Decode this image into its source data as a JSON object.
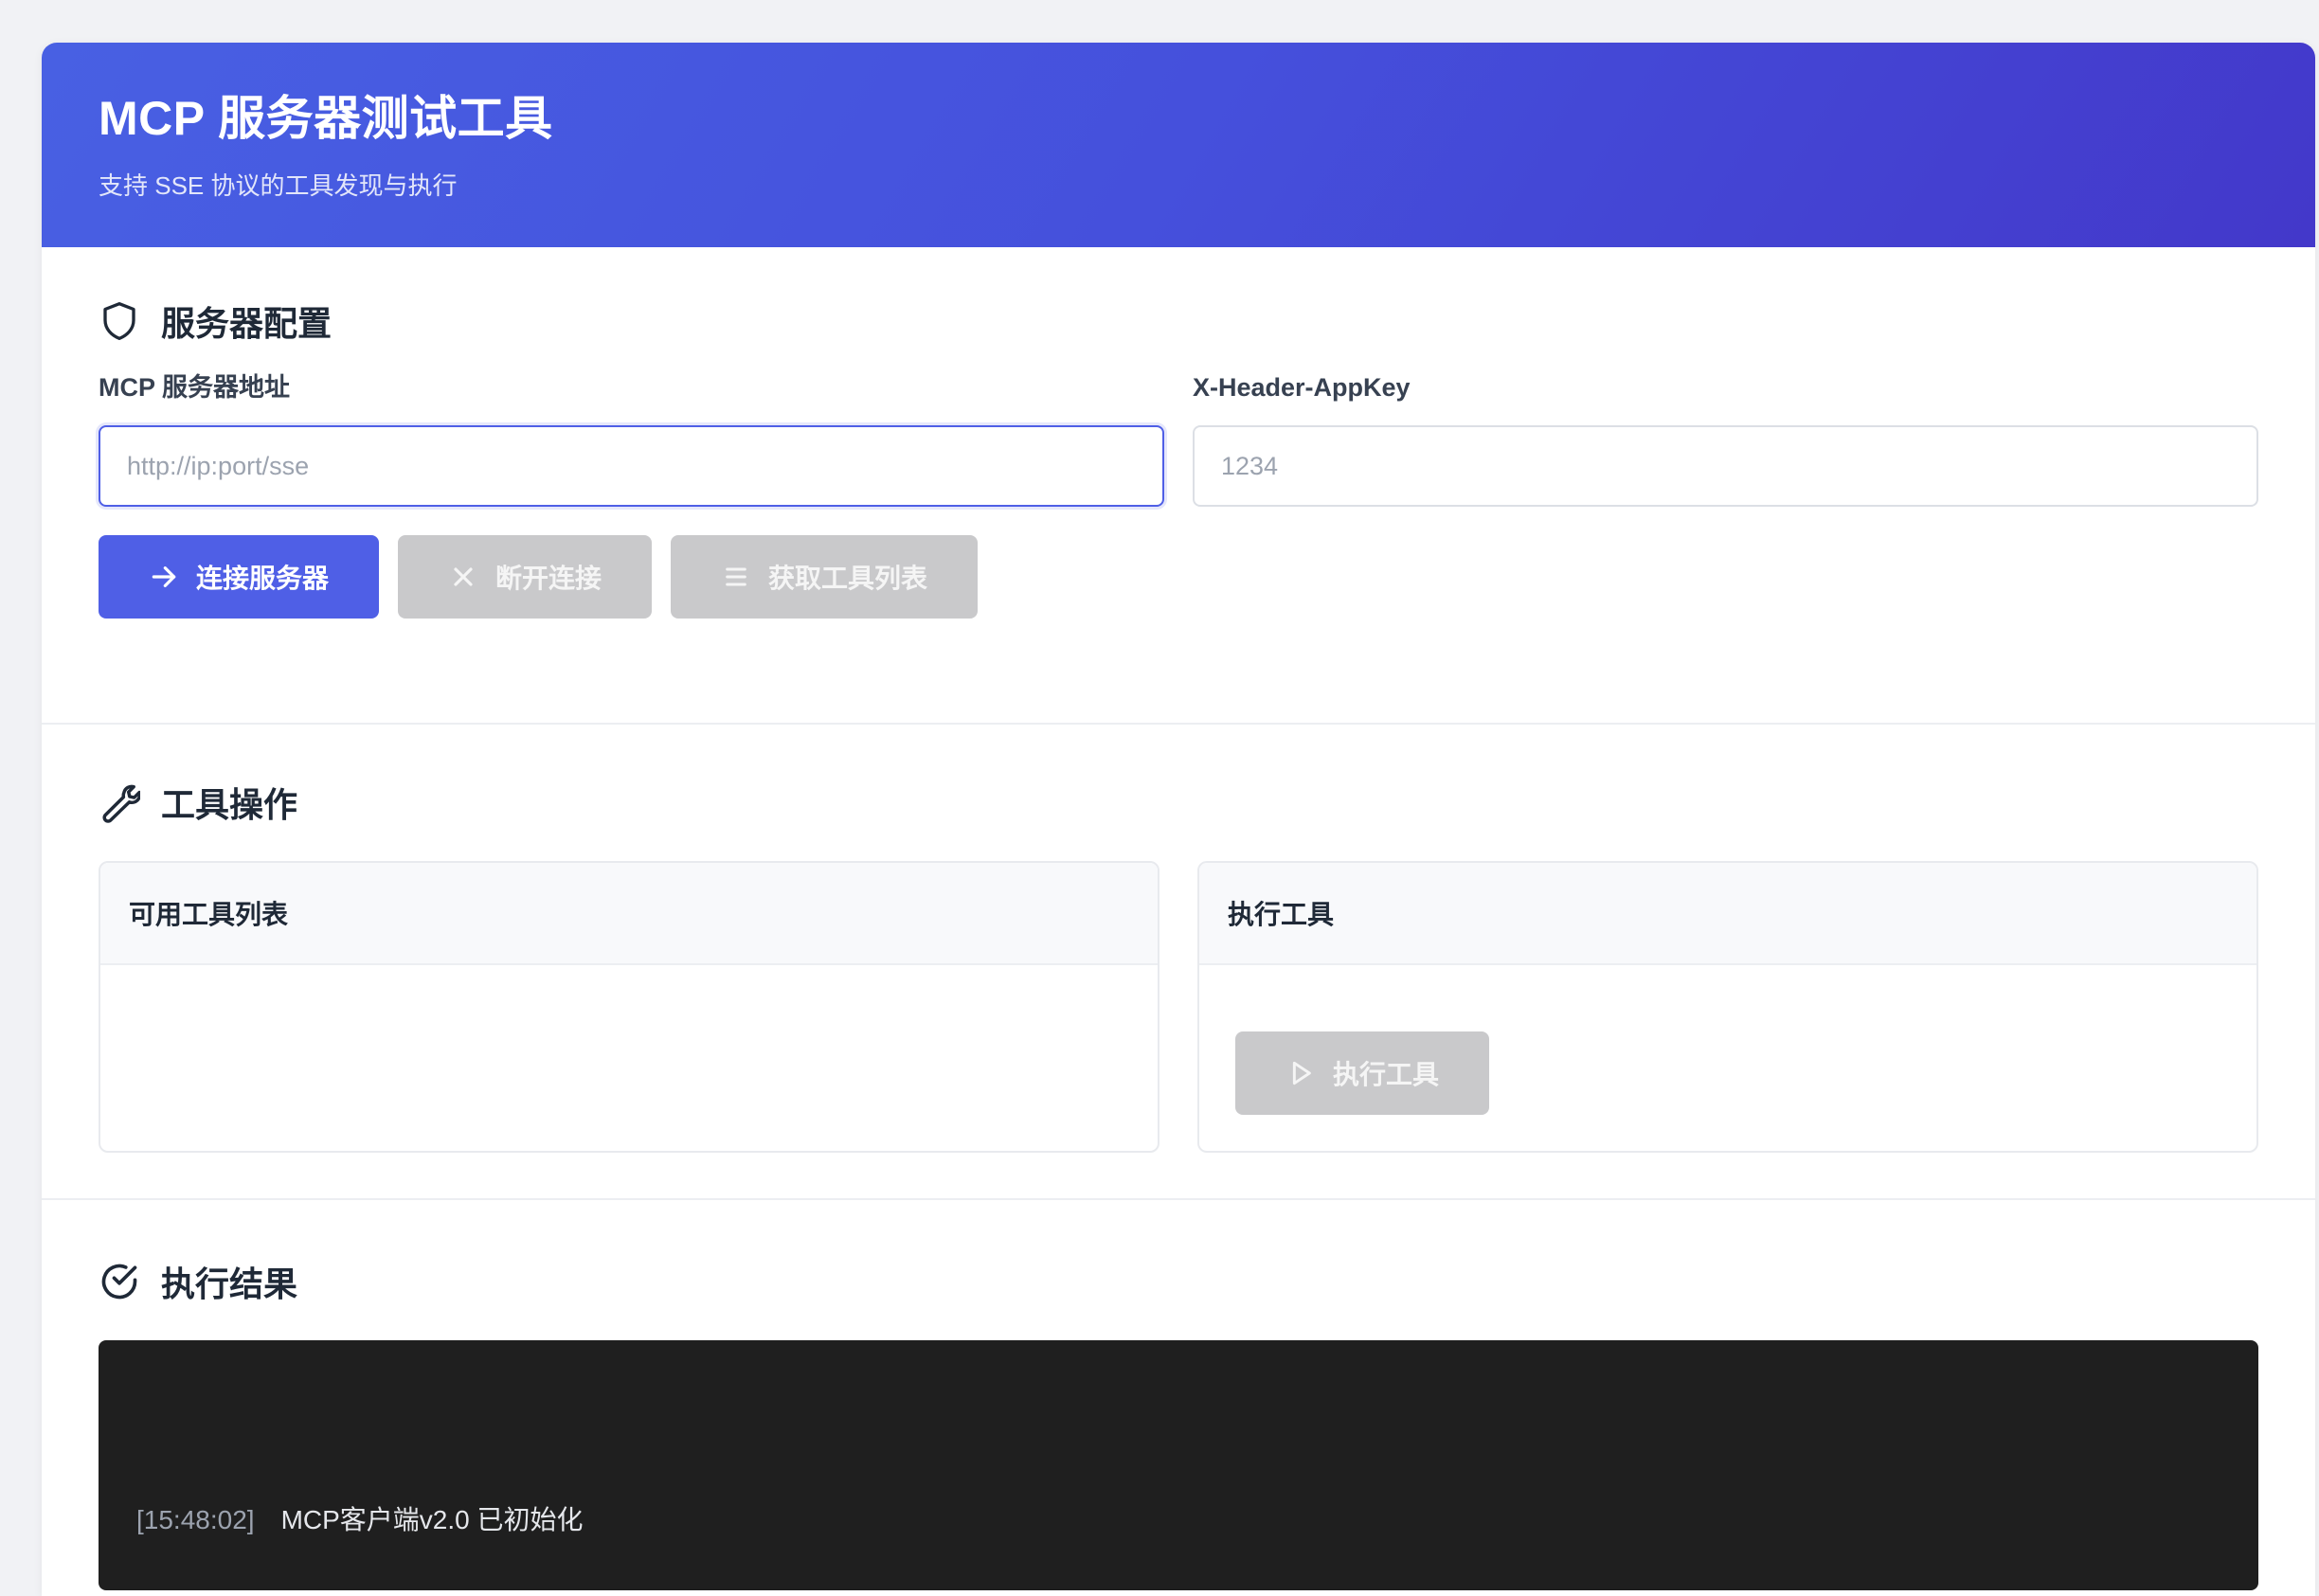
{
  "header": {
    "title": "MCP 服务器测试工具",
    "subtitle": "支持 SSE 协议的工具发现与执行"
  },
  "config": {
    "section_title": "服务器配置",
    "section_icon": "shield-icon",
    "server_url": {
      "label": "MCP 服务器地址",
      "placeholder": "http://ip:port/sse",
      "value": ""
    },
    "app_key": {
      "label": "X-Header-AppKey",
      "placeholder": "1234",
      "value": ""
    },
    "buttons": {
      "connect": "连接服务器",
      "disconnect": "断开连接",
      "list_tools": "获取工具列表"
    }
  },
  "tools": {
    "section_title": "工具操作",
    "section_icon": "wrench-icon",
    "available_title": "可用工具列表",
    "execute_title": "执行工具",
    "execute_button": "执行工具"
  },
  "results": {
    "section_title": "执行结果",
    "section_icon": "check-circle-icon",
    "logs": [
      {
        "time": "[15:48:02]",
        "message": "MCP客户端v2.0 已初始化"
      }
    ]
  },
  "colors": {
    "primary": "#4f5fe6",
    "header_gradient_start": "#4860e3",
    "header_gradient_end": "#4338ca",
    "disabled": "#c9c9cb",
    "console_bg": "#1f1f1f"
  }
}
